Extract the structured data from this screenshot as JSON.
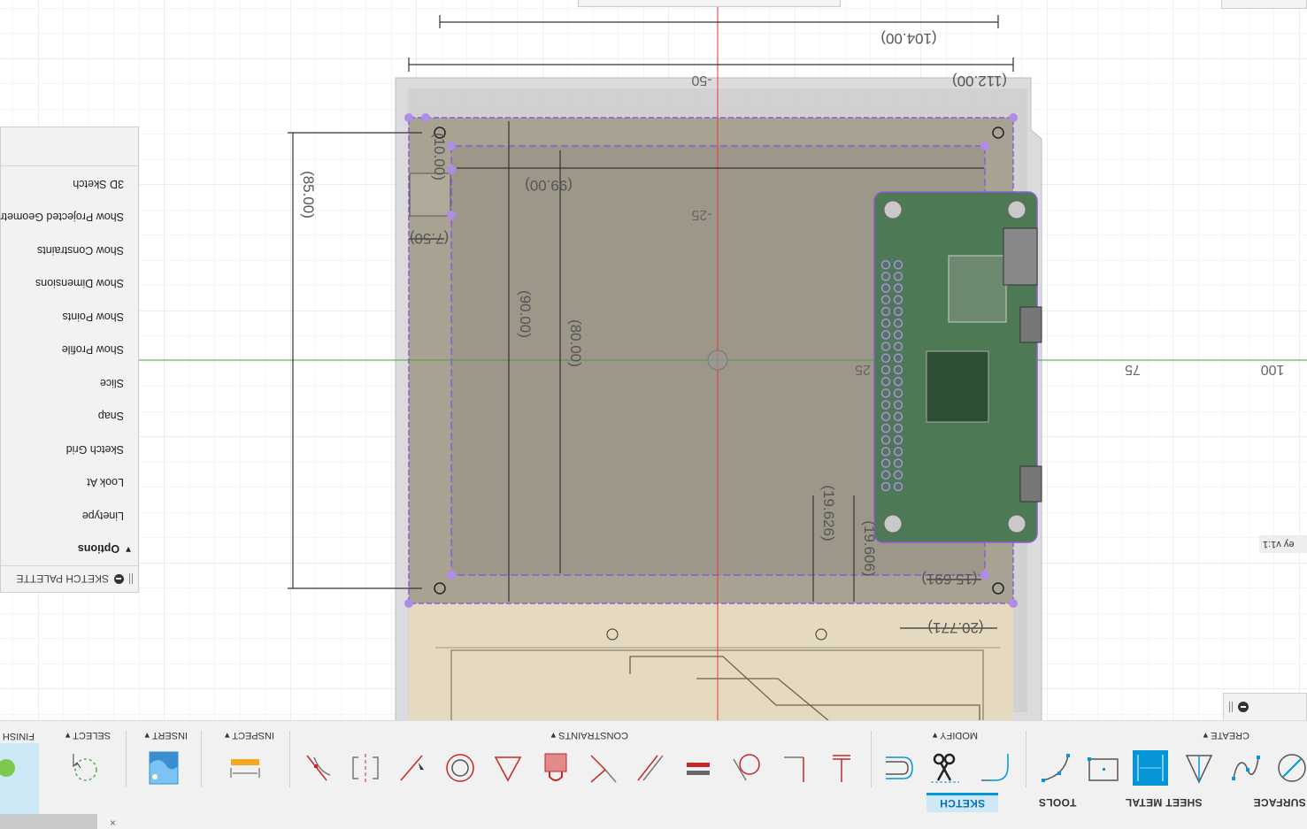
{
  "toolbar": {
    "workspace_tabs": [
      {
        "label": "SURFACE",
        "active": false
      },
      {
        "label": "SHEET METAL",
        "active": false
      },
      {
        "label": "TOOLS",
        "active": false
      },
      {
        "label": "SKETCH",
        "active": true
      }
    ],
    "groups": {
      "create": "CREATE ▾",
      "modify": "MODIFY ▾",
      "constraints": "CONSTRAINTS ▾",
      "inspect": "INSPECT ▾",
      "insert": "INSERT ▾",
      "select": "SELECT ▾",
      "finish": "FINISH"
    },
    "create_icons": [
      "circle-icon",
      "spline-icon",
      "polygon-icon",
      "sheet-metal-flange-icon",
      "rectangle-icon",
      "arc-icon"
    ],
    "modify_icons": [
      "fillet-icon",
      "trim-scissors-icon",
      "offset-icon"
    ],
    "constraint_icons": [
      "fix-icon",
      "perpendicular-icon",
      "tangent-icon",
      "equal-icon",
      "parallel-icon",
      "collinear-icon",
      "lock-icon",
      "triangle-icon",
      "concentric-icon",
      "midpoint-icon",
      "symmetry-icon",
      "coincident-icon"
    ],
    "accent": "#0696d7"
  },
  "sketch_palette": {
    "title": "SKETCH PALETTE",
    "options_label": "Options",
    "items": [
      "Linetype",
      "Look At",
      "Sketch Grid",
      "Snap",
      "Slice",
      "Show Profile",
      "Show Points",
      "Show Dimensions",
      "Show Constraints",
      "Show Projected Geometries",
      "3D Sketch"
    ]
  },
  "history_badge": "ey v1:1",
  "axis_labels": {
    "x100": "100",
    "x75": "75",
    "x25": "25",
    "y_m25": "-25",
    "y_m50": "-50"
  },
  "dimensions": {
    "d104": "(104.00)",
    "d112": "(112.00)",
    "d85": "(85.00)",
    "d99": "(99.00)",
    "d90": "(90.00)",
    "d80": "(80.00)",
    "d7_5": "(7.50)",
    "d19_626": "(19.626)",
    "d19_606": "(19.606)",
    "d15_691": "(15.691)",
    "d20_771": "(20.771)",
    "d10": "(10.00)"
  },
  "colors": {
    "x_axis": "#e53935",
    "y_axis": "#43a047",
    "sketch_line": "#8a5cd6",
    "board": "#4d7a55"
  }
}
